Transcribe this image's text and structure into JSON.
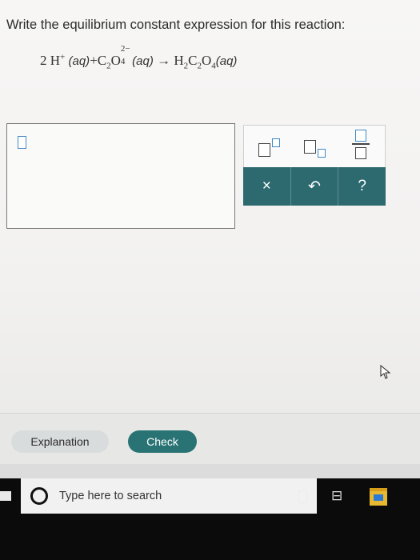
{
  "prompt": "Write the equilibrium constant expression for this reaction:",
  "equation": {
    "coef": "2",
    "h": "H",
    "plus_charge": "+",
    "aq1": "(aq)",
    "plus": "+",
    "c": "C",
    "c_sub": "2",
    "o": "O",
    "o_sub": "4",
    "o_sup": "2−",
    "aq2": "(aq)",
    "arrow": "→",
    "product_h": "H",
    "product_h_sub": "2",
    "product_c": "C",
    "product_c_sub": "2",
    "product_o": "O",
    "product_o_sub": "4",
    "aq3": "(aq)"
  },
  "palette": {
    "top": [
      "superscript-template",
      "subscript-template",
      "fraction-template"
    ],
    "clear_label": "×",
    "undo_label": "↶",
    "help_label": "?"
  },
  "buttons": {
    "explanation": "Explanation",
    "check": "Check"
  },
  "taskbar": {
    "search_placeholder": "Type here to search",
    "taskview_glyph": "⊟"
  },
  "colors": {
    "teal": "#2c6a70",
    "check_bg": "#2a7374",
    "slot_blue": "#4a8ac9"
  }
}
